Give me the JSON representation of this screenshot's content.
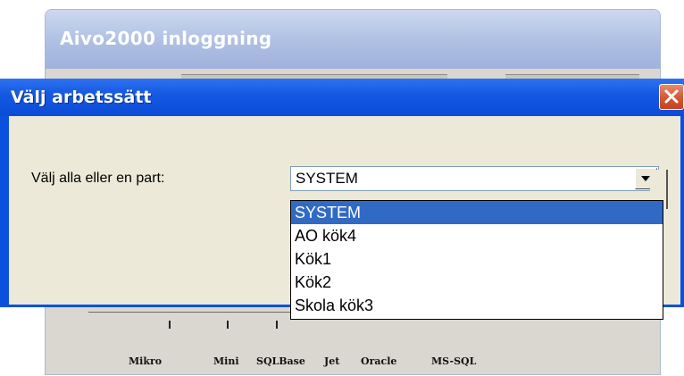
{
  "background_window": {
    "title": "Aivo2000 inloggning",
    "scale_labels": [
      "Mikro",
      "Mini",
      "SQLBase",
      "Jet",
      "Oracle",
      "MS-SQL"
    ]
  },
  "dialog": {
    "title": "Välj arbetssätt",
    "part_label": "Välj alla eller en part:",
    "selected_value": "SYSTEM",
    "options": [
      "SYSTEM",
      "AO kök4",
      "Kök1",
      "Kök2",
      "Skola kök3"
    ],
    "highlighted_index": 0
  },
  "icons": {
    "close": "close-icon",
    "dropdown": "chevron-down-icon"
  },
  "colors": {
    "title_bar": "#0b4cd6",
    "close_button": "#d5572f",
    "selection": "#316ac5",
    "dialog_body": "#ece9d8"
  }
}
